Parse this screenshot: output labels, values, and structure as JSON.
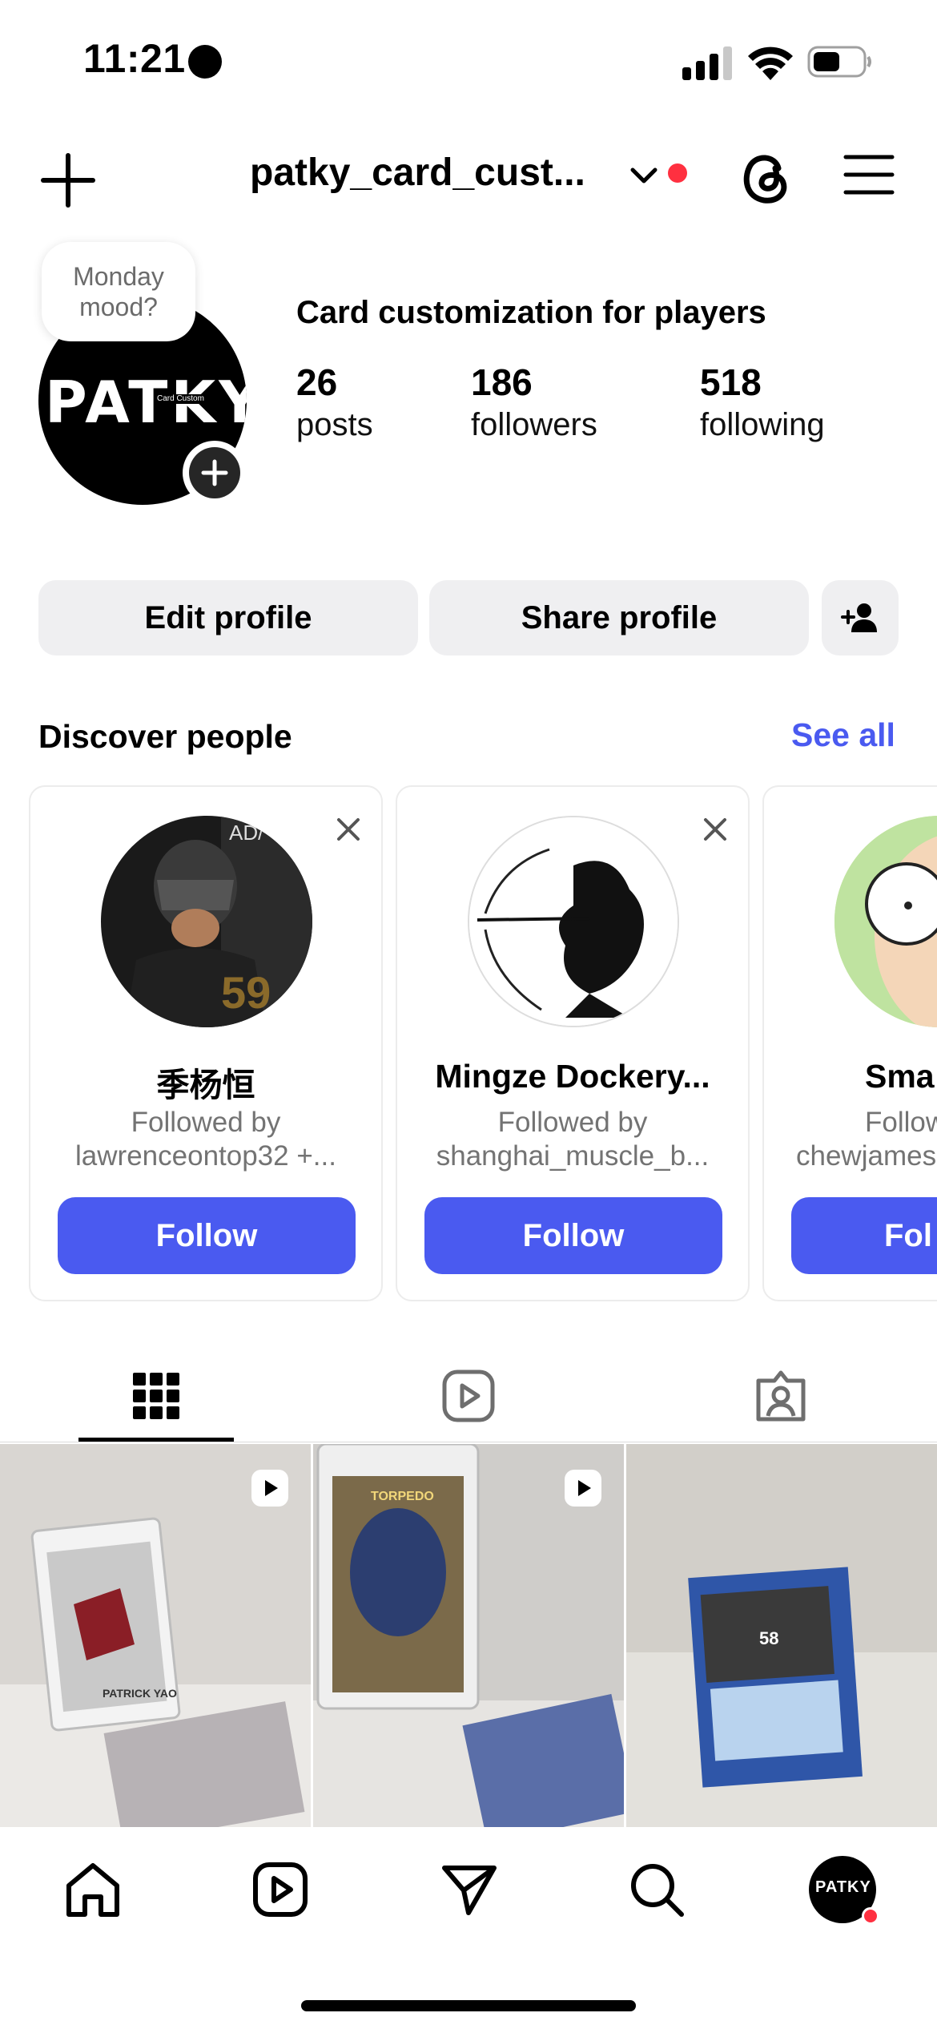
{
  "status": {
    "time": "11:21"
  },
  "header": {
    "username": "patky_card_cust...",
    "icons": [
      "plus-icon",
      "chevron-down-icon",
      "threads-icon",
      "hamburger-menu-icon"
    ]
  },
  "profile": {
    "note": "Monday mood?",
    "avatar_logo": "PATKY",
    "avatar_sub": "Card Custom",
    "bio": "Card customization for players",
    "stats": [
      {
        "value": "26",
        "label": "posts"
      },
      {
        "value": "186",
        "label": "followers"
      },
      {
        "value": "518",
        "label": "following"
      }
    ]
  },
  "actions": {
    "edit_profile": "Edit profile",
    "share_profile": "Share profile",
    "add_person_icon": "add-person-icon"
  },
  "discover": {
    "title": "Discover people",
    "see_all": "See all",
    "cards": [
      {
        "name": "季杨恒",
        "sub1": "Followed by",
        "sub2": "lawrenceontop32 +...",
        "follow": "Follow"
      },
      {
        "name": "Mingze Dockery...",
        "sub1": "Followed by",
        "sub2": "shanghai_muscle_b...",
        "follow": "Follow"
      },
      {
        "name": "Sma",
        "sub1": "Follow",
        "sub2": "chewjames",
        "follow": "Fol"
      }
    ]
  },
  "tabs": [
    "grid-icon",
    "reels-icon",
    "tagged-icon"
  ],
  "grid": {
    "cells": [
      {
        "type": "reel",
        "caption": "PATRICK YAO"
      },
      {
        "type": "reel",
        "caption": "TORPEDO"
      },
      {
        "type": "photo",
        "caption": "58"
      }
    ]
  },
  "bottom_nav": {
    "items": [
      "home-icon",
      "reels-icon",
      "messages-icon",
      "search-icon",
      "profile-avatar"
    ],
    "avatar_text": "PATKY"
  },
  "colors": {
    "accent": "#4a5af0",
    "notification": "#ff3040",
    "button_gray": "#efeff1"
  }
}
